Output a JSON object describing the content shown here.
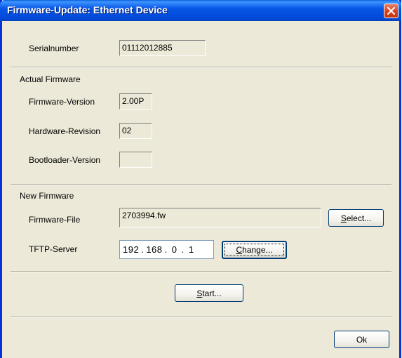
{
  "window": {
    "title": "Firmware-Update: Ethernet Device"
  },
  "serial": {
    "label": "Serialnumber",
    "value": "01112012885"
  },
  "actual_firmware": {
    "heading": "Actual Firmware",
    "firmware_version_label": "Firmware-Version",
    "firmware_version_value": "2.00P",
    "hardware_revision_label": "Hardware-Revision",
    "hardware_revision_value": "02",
    "bootloader_version_label": "Bootloader-Version",
    "bootloader_version_value": ""
  },
  "new_firmware": {
    "heading": "New Firmware",
    "firmware_file_label": "Firmware-File",
    "firmware_file_value": "2703994.fw",
    "select_pre": "",
    "select_mnemonic": "S",
    "select_post": "elect...",
    "tftp_label": "TFTP-Server",
    "tftp_octets": [
      "192",
      "168",
      "0",
      "1"
    ],
    "change_pre": "",
    "change_mnemonic": "C",
    "change_post": "hange..."
  },
  "actions": {
    "start_pre": "",
    "start_mnemonic": "S",
    "start_post": "tart...",
    "ok_label": "Ok"
  },
  "colors": {
    "titlebar": "#0054e3",
    "dialog_bg": "#ece9d8",
    "close_button": "#d9441f"
  },
  "icons": {
    "close": "close-icon"
  }
}
